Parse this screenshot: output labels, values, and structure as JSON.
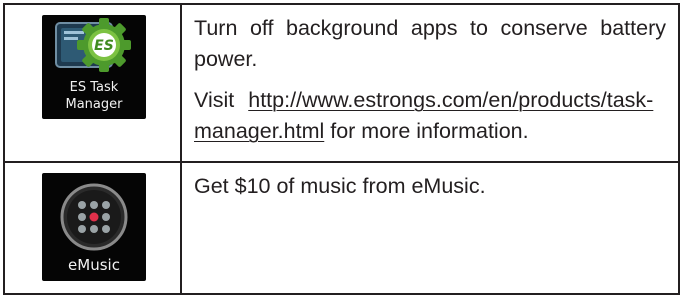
{
  "rows": [
    {
      "app": {
        "name": "ES Task\nManager",
        "icon": "es-task-manager-icon"
      },
      "description": "Turn off background apps to conserve battery power.",
      "more_info": {
        "prefix": "Visit",
        "link_text": "http://www.estrongs.com/en/products/task-manager.html",
        "suffix": " for more information."
      }
    },
    {
      "app": {
        "name": "eMusic",
        "icon": "emusic-icon"
      },
      "description": "Get $10 of music from eMusic."
    }
  ],
  "colors": {
    "text": "#231f20",
    "tile_background": "#050505",
    "emusic_accent": "#e0304a",
    "es_green": "#7cc242"
  }
}
